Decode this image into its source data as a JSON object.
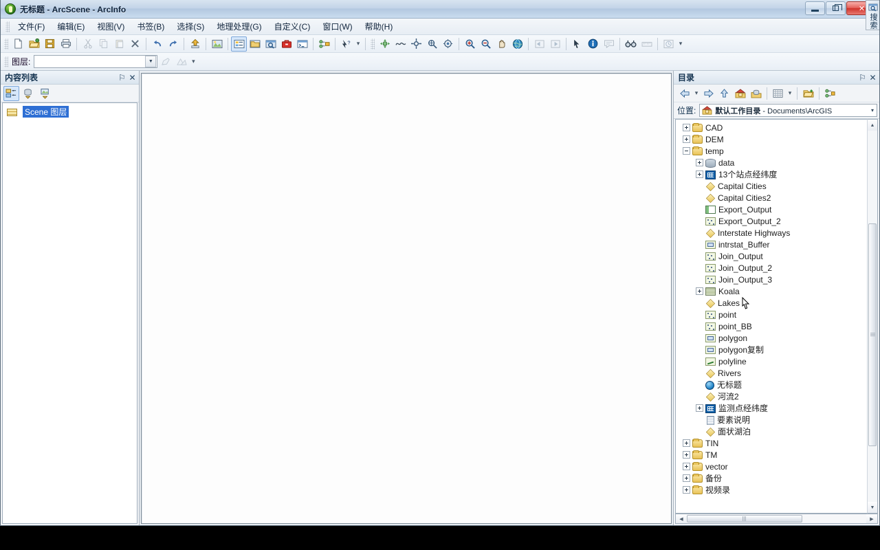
{
  "window": {
    "title": "无标题 - ArcScene - ArcInfo",
    "app_icon": "arcscene-globe-icon",
    "minimize_label": "最小化",
    "restore_label": "向下还原",
    "close_label": "关闭"
  },
  "menu": {
    "items": [
      {
        "label": "文件(F)",
        "name": "menu-file"
      },
      {
        "label": "编辑(E)",
        "name": "menu-edit"
      },
      {
        "label": "视图(V)",
        "name": "menu-view"
      },
      {
        "label": "书签(B)",
        "name": "menu-bookmarks"
      },
      {
        "label": "选择(S)",
        "name": "menu-selection"
      },
      {
        "label": "地理处理(G)",
        "name": "menu-geoprocessing"
      },
      {
        "label": "自定义(C)",
        "name": "menu-customize"
      },
      {
        "label": "窗口(W)",
        "name": "menu-window"
      },
      {
        "label": "帮助(H)",
        "name": "menu-help"
      }
    ]
  },
  "standard_toolbar": {
    "buttons": [
      {
        "name": "new-document-icon",
        "glyph": "⬜",
        "enabled": true
      },
      {
        "name": "open-document-icon",
        "glyph": "📂",
        "enabled": true
      },
      {
        "name": "save-icon",
        "glyph": "💾",
        "enabled": true
      },
      {
        "name": "print-icon",
        "glyph": "🖨",
        "enabled": true
      },
      {
        "name": "cut-icon",
        "glyph": "✂",
        "enabled": false
      },
      {
        "name": "copy-icon",
        "glyph": "⧉",
        "enabled": false
      },
      {
        "name": "paste-icon",
        "glyph": "📋",
        "enabled": false
      },
      {
        "name": "delete-icon",
        "glyph": "✕",
        "enabled": true
      },
      {
        "name": "undo-icon",
        "glyph": "↶",
        "enabled": true
      },
      {
        "name": "redo-icon",
        "glyph": "↷",
        "enabled": true
      },
      {
        "name": "add-data-icon",
        "glyph": "⬇",
        "enabled": true
      },
      {
        "name": "scene-properties-icon",
        "glyph": "🖼",
        "enabled": true
      },
      {
        "name": "table-of-contents-icon",
        "glyph": "☰",
        "enabled": true,
        "active": true
      },
      {
        "name": "catalog-window-icon",
        "glyph": "🗂",
        "enabled": true
      },
      {
        "name": "search-window-icon",
        "glyph": "🔍",
        "enabled": true
      },
      {
        "name": "arctoolbox-icon",
        "glyph": "🧰",
        "enabled": true
      },
      {
        "name": "python-window-icon",
        "glyph": "⬛",
        "enabled": true
      },
      {
        "name": "model-builder-icon",
        "glyph": "⛓",
        "enabled": true
      },
      {
        "name": "whats-this-help-icon",
        "glyph": "?",
        "enabled": true
      }
    ]
  },
  "tools_toolbar": {
    "buttons": [
      {
        "name": "navigate-icon",
        "glyph": "✥",
        "enabled": true
      },
      {
        "name": "fly-icon",
        "glyph": "∿",
        "enabled": true
      },
      {
        "name": "center-on-target-icon",
        "glyph": "⊕",
        "enabled": true
      },
      {
        "name": "zoom-to-target-icon",
        "glyph": "⌕",
        "enabled": true
      },
      {
        "name": "set-observer-icon",
        "glyph": "◎",
        "enabled": true
      },
      {
        "name": "zoom-in-icon",
        "glyph": "⌕",
        "enabled": true
      },
      {
        "name": "zoom-out-icon",
        "glyph": "⊖",
        "enabled": true
      },
      {
        "name": "pan-icon",
        "glyph": "✋",
        "enabled": true
      },
      {
        "name": "full-extent-icon",
        "glyph": "🌍",
        "enabled": true
      },
      {
        "name": "zoom-to-previous-extent-icon",
        "glyph": "◱",
        "enabled": false
      },
      {
        "name": "zoom-to-next-extent-icon",
        "glyph": "◲",
        "enabled": false
      },
      {
        "name": "select-features-icon",
        "glyph": "➤",
        "enabled": true
      },
      {
        "name": "identify-icon",
        "glyph": "i",
        "enabled": true
      },
      {
        "name": "html-popup-icon",
        "glyph": "💬",
        "enabled": false
      },
      {
        "name": "find-icon",
        "glyph": "🔭",
        "enabled": true
      },
      {
        "name": "measure-icon",
        "glyph": "📏",
        "enabled": false
      },
      {
        "name": "time-slider-icon",
        "glyph": "⏱",
        "enabled": false
      }
    ]
  },
  "layer_toolbar": {
    "label": "图层:",
    "combo_value": "",
    "combo_placeholder": "",
    "buttons": [
      {
        "name": "create-feature-icon",
        "glyph": "✎",
        "enabled": false
      },
      {
        "name": "3d-effects-icon",
        "glyph": "◳",
        "enabled": false
      }
    ]
  },
  "toc": {
    "title": "内容列表",
    "pin_label": "⚐",
    "close_label": "✕",
    "tools": [
      {
        "name": "list-by-drawing-order-icon",
        "active": true
      },
      {
        "name": "list-by-source-icon",
        "active": false
      },
      {
        "name": "list-by-visibility-icon",
        "active": false
      }
    ],
    "items": [
      {
        "label": "Scene 图层",
        "icon": "layers-icon",
        "selected": true
      }
    ]
  },
  "catalog": {
    "title": "目录",
    "pin_label": "⚐",
    "close_label": "✕",
    "nav_buttons": [
      {
        "name": "back-icon",
        "glyph": "⇦",
        "enabled": true
      },
      {
        "name": "back-dropdown-icon",
        "glyph": "▾",
        "enabled": true
      },
      {
        "name": "forward-icon",
        "glyph": "⇨",
        "enabled": true
      },
      {
        "name": "up-one-level-icon",
        "glyph": "⇧",
        "enabled": true
      },
      {
        "name": "home-folder-icon",
        "glyph": "🏠",
        "enabled": true
      },
      {
        "name": "default-geodatabase-icon",
        "glyph": "🗃",
        "enabled": true
      },
      {
        "name": "toggle-contents-panel-icon",
        "glyph": "▦",
        "enabled": true
      },
      {
        "name": "contents-dropdown-icon",
        "glyph": "▾",
        "enabled": true
      },
      {
        "name": "connect-to-folder-icon",
        "glyph": "📁",
        "enabled": true
      },
      {
        "name": "toolbox-icon",
        "glyph": "⚙",
        "enabled": true
      }
    ],
    "location": {
      "label": "位置:",
      "icon": "home-folder-icon",
      "value_bold": "默认工作目录",
      "value_rest": " - Documents\\ArcGIS",
      "dropdown_glyph": "▾"
    },
    "tree": [
      {
        "label": "CAD",
        "icon": "folder",
        "indent": 0,
        "expander": "plus"
      },
      {
        "label": "DEM",
        "icon": "folder",
        "indent": 0,
        "expander": "plus"
      },
      {
        "label": "temp",
        "icon": "folder",
        "indent": 0,
        "expander": "minus"
      },
      {
        "label": "data",
        "icon": "gdb",
        "indent": 1,
        "expander": "plus"
      },
      {
        "label": "13个站点经纬度",
        "icon": "grid",
        "indent": 1,
        "expander": "plus"
      },
      {
        "label": "Capital Cities",
        "icon": "diamond",
        "indent": 1,
        "expander": "none"
      },
      {
        "label": "Capital Cities2",
        "icon": "diamond",
        "indent": 1,
        "expander": "none"
      },
      {
        "label": "Export_Output",
        "icon": "table",
        "indent": 1,
        "expander": "none"
      },
      {
        "label": "Export_Output_2",
        "icon": "point",
        "indent": 1,
        "expander": "none"
      },
      {
        "label": "Interstate Highways",
        "icon": "diamond",
        "indent": 1,
        "expander": "none"
      },
      {
        "label": "intrstat_Buffer",
        "icon": "poly",
        "indent": 1,
        "expander": "none"
      },
      {
        "label": "Join_Output",
        "icon": "point",
        "indent": 1,
        "expander": "none"
      },
      {
        "label": "Join_Output_2",
        "icon": "point",
        "indent": 1,
        "expander": "none"
      },
      {
        "label": "Join_Output_3",
        "icon": "point",
        "indent": 1,
        "expander": "none"
      },
      {
        "label": "Koala",
        "icon": "raster",
        "indent": 1,
        "expander": "plus"
      },
      {
        "label": "Lakes",
        "icon": "diamond",
        "indent": 1,
        "expander": "none"
      },
      {
        "label": "point",
        "icon": "point",
        "indent": 1,
        "expander": "none"
      },
      {
        "label": "point_BB",
        "icon": "point",
        "indent": 1,
        "expander": "none"
      },
      {
        "label": "polygon",
        "icon": "poly",
        "indent": 1,
        "expander": "none"
      },
      {
        "label": "polygon复制",
        "icon": "poly",
        "indent": 1,
        "expander": "none"
      },
      {
        "label": "polyline",
        "icon": "line",
        "indent": 1,
        "expander": "none"
      },
      {
        "label": "Rivers",
        "icon": "diamond",
        "indent": 1,
        "expander": "none"
      },
      {
        "label": "无标题",
        "icon": "globe",
        "indent": 1,
        "expander": "none"
      },
      {
        "label": "河流2",
        "icon": "diamond",
        "indent": 1,
        "expander": "none"
      },
      {
        "label": "监测点经纬度",
        "icon": "grid",
        "indent": 1,
        "expander": "plus"
      },
      {
        "label": "要素说明",
        "icon": "doc",
        "indent": 1,
        "expander": "none"
      },
      {
        "label": "面状湖泊",
        "icon": "diamond",
        "indent": 1,
        "expander": "none"
      },
      {
        "label": "TIN",
        "icon": "folder",
        "indent": 0,
        "expander": "plus"
      },
      {
        "label": "TM",
        "icon": "folder",
        "indent": 0,
        "expander": "plus"
      },
      {
        "label": "vector",
        "icon": "folder",
        "indent": 0,
        "expander": "plus"
      },
      {
        "label": "备份",
        "icon": "folder",
        "indent": 0,
        "expander": "plus"
      },
      {
        "label": "视频录",
        "icon": "folder",
        "indent": 0,
        "expander": "plus"
      }
    ],
    "vscroll": {
      "up": "▲",
      "down": "▼"
    },
    "hscroll": {
      "left": "◀",
      "right": "▶"
    }
  },
  "dock_tab": {
    "label": "搜索",
    "icon": "search-window-icon"
  },
  "scene_view": {
    "background": "#fdfdfd"
  },
  "colors": {
    "selection_blue": "#2e6fd4",
    "titlebar_blue": "#b3c8e0",
    "close_red": "#cf3129",
    "folder_yellow": "#e8c257"
  }
}
